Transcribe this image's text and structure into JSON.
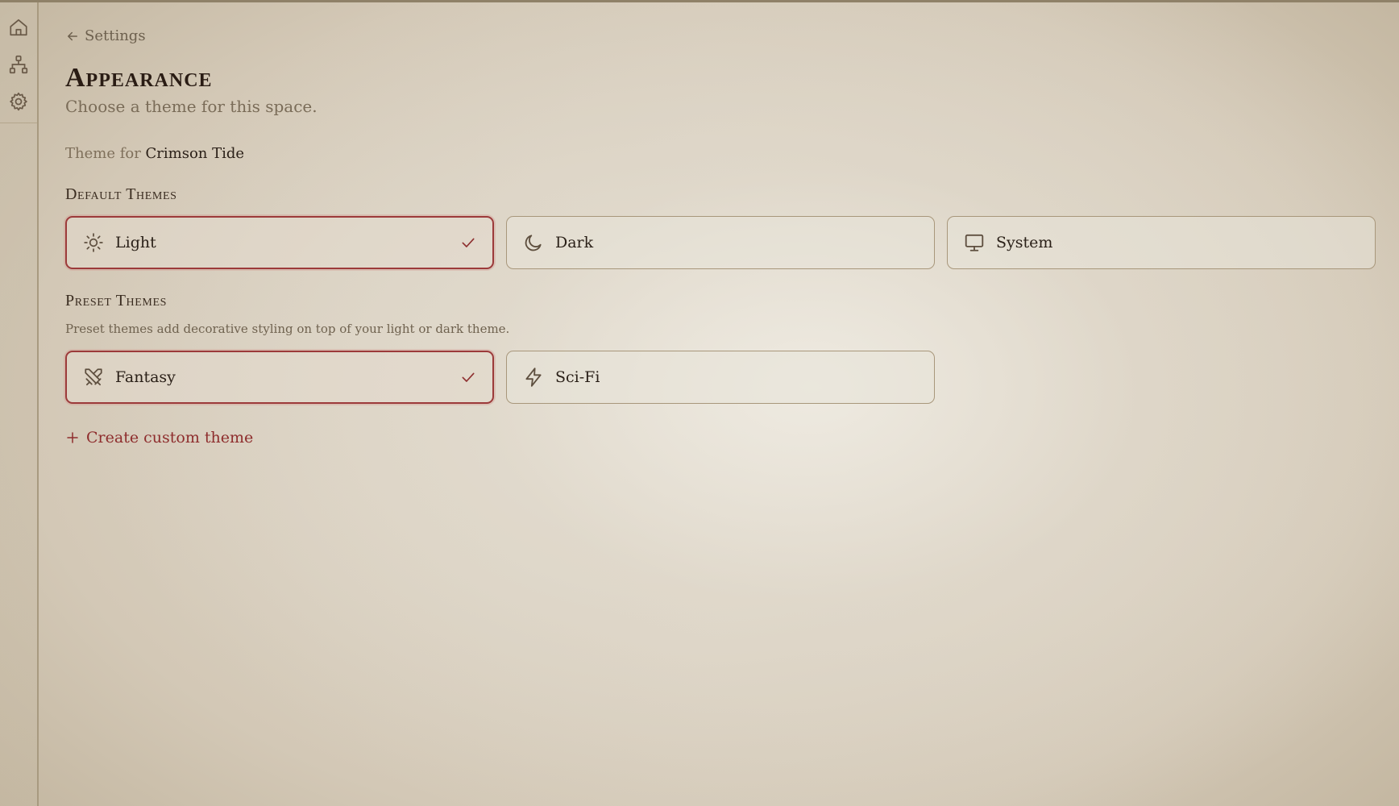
{
  "nav": {
    "back_label": "Settings",
    "rail_icons": [
      "home-icon",
      "sitemap-icon",
      "gear-icon"
    ]
  },
  "page": {
    "title": "Appearance",
    "subtitle": "Choose a theme for this space.",
    "theme_for_prefix": "Theme for",
    "space_name": "Crimson Tide"
  },
  "default_themes": {
    "heading": "Default Themes",
    "options": [
      {
        "label": "Light",
        "icon": "sun-icon",
        "selected": true
      },
      {
        "label": "Dark",
        "icon": "moon-icon",
        "selected": false
      },
      {
        "label": "System",
        "icon": "monitor-icon",
        "selected": false
      }
    ]
  },
  "preset_themes": {
    "heading": "Preset Themes",
    "description": "Preset themes add decorative styling on top of your light or dark theme.",
    "options": [
      {
        "label": "Fantasy",
        "icon": "crossed-swords-icon",
        "selected": true
      },
      {
        "label": "Sci-Fi",
        "icon": "lightning-icon",
        "selected": false
      }
    ]
  },
  "actions": {
    "create_custom_label": "Create custom theme"
  },
  "colors": {
    "accent": "#9c3a3a",
    "background": "#e3ddd1",
    "border": "#a8977b"
  }
}
